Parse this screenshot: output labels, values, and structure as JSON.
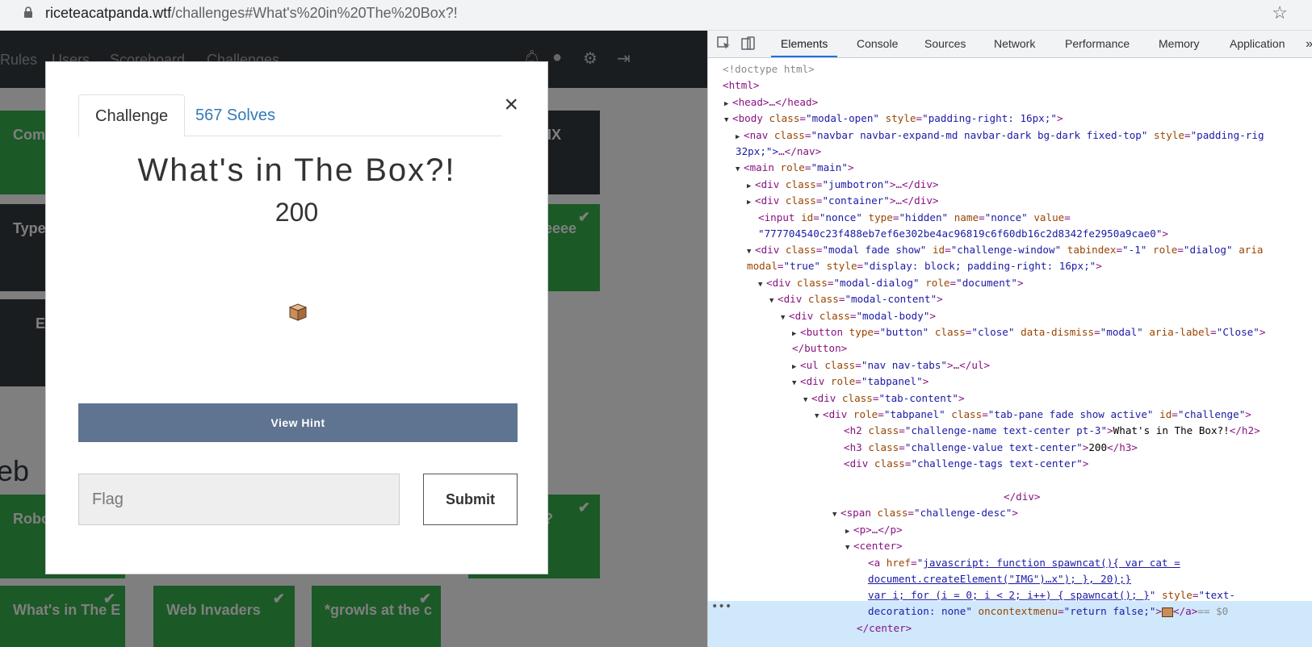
{
  "browser": {
    "host": "riceteacatpanda.wtf",
    "path": "/challenges#What's%20in%20The%20Box?!"
  },
  "site": {
    "nav": [
      "Rules",
      "Users",
      "Scoreboard",
      "Challenges"
    ],
    "nav_icons": [
      "bell-icon",
      "user-icon",
      "settings-icon",
      "logout-icon"
    ],
    "cards": [
      {
        "label": "Com",
        "style": "green"
      },
      {
        "label": "IX",
        "style": "dark"
      },
      {
        "label": "Type",
        "style": "dark"
      },
      {
        "label": "eeee",
        "style": "green",
        "solved": true
      },
      {
        "label": "E",
        "style": "dark"
      },
      {
        "label": "Robo",
        "style": "green"
      },
      {
        "label": "?",
        "style": "green",
        "solved": true
      },
      {
        "label": "What's in The E",
        "style": "green",
        "solved": true
      },
      {
        "label": "Web Invaders",
        "style": "green",
        "solved": true
      },
      {
        "label": "*growls at the c",
        "style": "green",
        "solved": true
      }
    ],
    "section_heading": "eb"
  },
  "modal": {
    "tab_challenge": "Challenge",
    "tab_solves": "567 Solves",
    "close": "×",
    "challenge_name": "What's in The Box?!",
    "challenge_value": "200",
    "hint_button": "View Hint",
    "flag_placeholder": "Flag",
    "submit": "Submit"
  },
  "devtools": {
    "tabs": [
      "Elements",
      "Console",
      "Sources",
      "Network",
      "Performance",
      "Memory",
      "Application"
    ],
    "active_tab": "Elements",
    "more": "»",
    "dom": {
      "l1": "<!doctype html>",
      "l2": "<html>",
      "l3_tag": "<head>",
      "l3_tail": "…</head>",
      "l4_attr1": "class",
      "l4_val1": "\"modal-open\"",
      "l4_attr2": "style",
      "l4_val2": "\"padding-right: 16px;\"",
      "l5_val1": "\"navbar navbar-expand-md navbar-dark bg-dark fixed-top\"",
      "l5_attr2": "style",
      "l5_val2": "\"padding-rig",
      "l6": "32px;\">",
      "l6_tail": "…</nav>",
      "l7_val": "\"main\"",
      "l8_val": "\"jumbotron\"",
      "l9_val": "\"container\"",
      "l10_val1": "\"nonce\"",
      "l10_val2": "\"hidden\"",
      "l10_val3": "\"nonce\"",
      "l11_val": "\"777704540c23f488eb7ef6e302be4ac96819c6f60db16c2d8342fe2950a9cae0\"",
      "l12_val1": "\"modal fade show\"",
      "l12_val2": "\"challenge-window\"",
      "l12_val3": "\"-1\"",
      "l12_val4": "\"dialog\"",
      "l12_tail": "aria",
      "l13_val1": "\"true\"",
      "l13_val2": "\"display: block; padding-right: 16px;\"",
      "l14_val1": "\"modal-dialog\"",
      "l14_val2": "\"document\"",
      "l15_val": "\"modal-content\"",
      "l16_val": "\"modal-body\"",
      "l17_val1": "\"button\"",
      "l17_val2": "\"close\"",
      "l17_val3": "\"modal\"",
      "l17_val4": "\"Close\"",
      "l18": "</button>",
      "l19_val": "\"nav nav-tabs\"",
      "l20_val": "\"tabpanel\"",
      "l21_val": "\"tab-content\"",
      "l22_val1": "\"tabpanel\"",
      "l22_val2": "\"tab-pane fade show active\"",
      "l22_val3": "\"challenge\"",
      "l23_val": "\"challenge-name text-center pt-3\"",
      "l23_text": "What's in The Box?!",
      "l24_val": "\"challenge-value text-center\"",
      "l24_text": "200",
      "l25_val": "\"challenge-tags text-center\"",
      "l26": "</div>",
      "l27_val": "\"challenge-desc\"",
      "l28": "…</p>",
      "l29": "<center>",
      "l30_link": "javascript: function spawncat(){ var cat =",
      "l31_link": "document.createElement(\"IMG\")…x\"); }, 20);}",
      "l32_link": "var i; for (i = 0; i < 2; i++) { spawncat(); }",
      "l32_attr": "style",
      "l32_val": "\"text-",
      "l33_val1": "decoration: none\"",
      "l33_attr": "oncontextmenu",
      "l33_val2": "\"return false;\"",
      "l33_tail": "== $0",
      "l34": "</center>"
    }
  },
  "colors": {
    "navbar": "#343a40",
    "card_green": "#37b24d",
    "hint_button": "#5e7491",
    "link_blue": "#337ab7",
    "devtools_selection": "#cfe8fc"
  }
}
